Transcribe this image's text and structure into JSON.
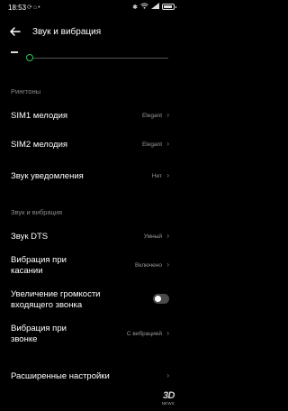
{
  "status_bar": {
    "time": "18:53",
    "left_icons": [
      "sync-icon",
      "notification-icon",
      "dot-icon"
    ],
    "right_icons": [
      "bluetooth-icon",
      "wifi-icon",
      "signal-icon",
      "battery-icon"
    ]
  },
  "header": {
    "title": "Звук и вибрация"
  },
  "volume_slider": {
    "level": 0.0,
    "accent_color": "#2fc25b"
  },
  "sections": {
    "ringtones": "Рингтоны",
    "sound_vibration": "Звук и вибрация"
  },
  "rows": {
    "sim1": {
      "label": "SIM1 мелодия",
      "value": "Elegant"
    },
    "sim2": {
      "label": "SIM2 мелодия",
      "value": "Elegant"
    },
    "notification": {
      "label": "Звук уведомления",
      "value": "Нет"
    },
    "dts": {
      "label": "Звук DTS",
      "value": "Умный"
    },
    "touch_vibration": {
      "label_line1": "Вибрация при",
      "label_line2": "касании",
      "value": "Включено"
    },
    "volume_increase": {
      "label_line1": "Увеличение громкости",
      "label_line2": "входящего звонка",
      "toggle_on": false
    },
    "call_vibration": {
      "label_line1": "Вибрация при",
      "label_line2": "звонке",
      "value": "С вибрацией"
    },
    "advanced": {
      "label": "Расширенные настройки"
    }
  },
  "watermark": {
    "main": "3D",
    "sub": "NEWS"
  }
}
